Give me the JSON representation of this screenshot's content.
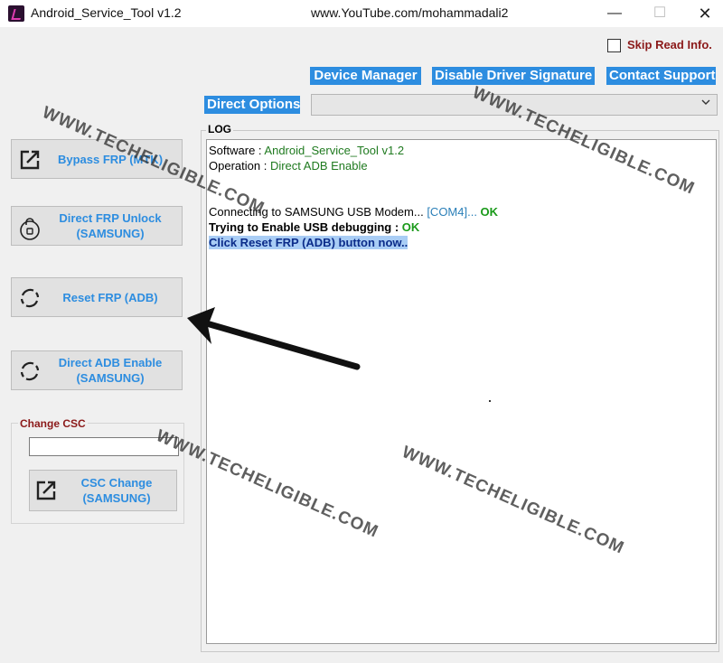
{
  "window": {
    "title": "Android_Service_Tool v1.2",
    "center_text": "www.YouTube.com/mohammadali2",
    "min_glyph": "—",
    "max_glyph": "☐",
    "close_glyph": "✕"
  },
  "options": {
    "skip_read_info_label": "Skip Read Info.",
    "skip_read_info_checked": false
  },
  "toolbar": {
    "device_manager": "Device Manager",
    "disable_driver_signature": "Disable Driver Signature",
    "contact_support": "Contact Support",
    "direct_options": "Direct Options",
    "direct_options_value": ""
  },
  "sidebar": {
    "bypass_frp": {
      "line1": "Bypass FRP (MTK)",
      "line2": "",
      "icon": "external-link-icon"
    },
    "direct_frp_unlock": {
      "line1": "Direct FRP Unlock",
      "line2": "(SAMSUNG)",
      "icon": "lock-icon"
    },
    "reset_frp": {
      "line1": "Reset FRP (ADB)",
      "line2": "",
      "icon": "refresh-icon"
    },
    "direct_adb": {
      "line1": "Direct ADB Enable",
      "line2": "(SAMSUNG)",
      "icon": "refresh-icon"
    }
  },
  "csc": {
    "title": "Change CSC",
    "input_value": "",
    "button_line1": "CSC Change",
    "button_line2": "(SAMSUNG)"
  },
  "log": {
    "title": "LOG",
    "software_label": "Software : ",
    "software_value": "Android_Service_Tool v1.2",
    "operation_label": "Operation : ",
    "operation_value": "Direct ADB Enable",
    "connecting_text": "Connecting to SAMSUNG USB Modem... ",
    "connecting_port": "[COM4]...",
    "connecting_status": " OK",
    "debug_text": "Trying to Enable USB debugging : ",
    "debug_status": "OK",
    "instruction": "Click Reset FRP (ADB) button now.."
  },
  "watermark": "WWW.TECHELIGIBLE.COM",
  "colors": {
    "accent_blue": "#2d8de0",
    "log_green": "#1f7a1f",
    "status_ok_green": "#1a9a1a",
    "label_maroon": "#8b1a1a",
    "highlight": "#a9cdf5"
  }
}
